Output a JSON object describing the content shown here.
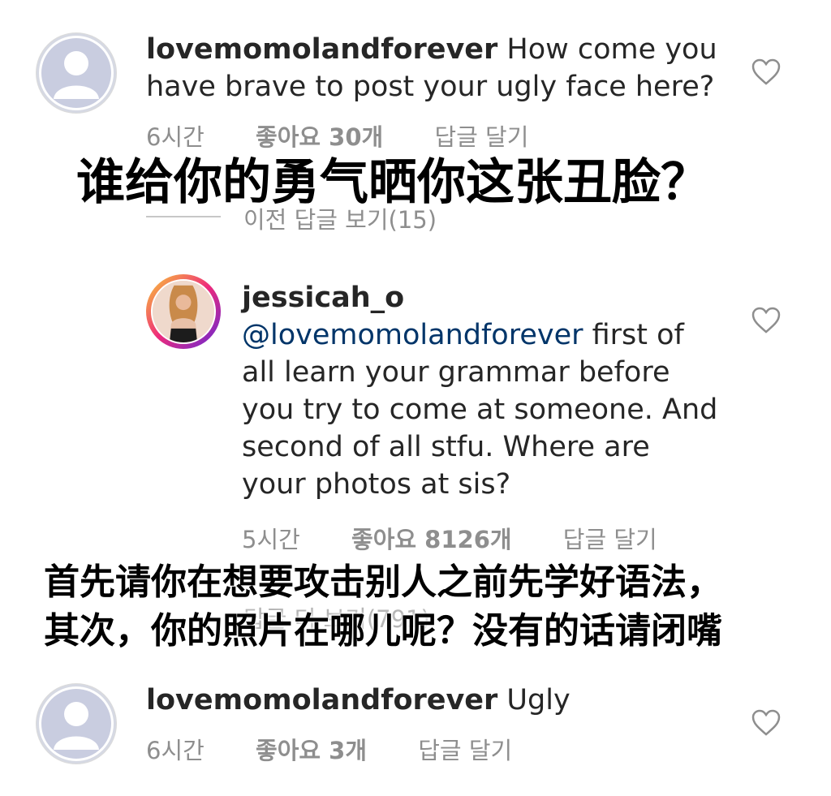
{
  "comments": [
    {
      "username": "lovemomolandforever",
      "text_line1": " How come you",
      "text_line2": "have brave to post your ugly face here?",
      "time": "6시간",
      "likes": "좋아요 30개",
      "reply": "답글 달기",
      "view_replies": "이전 답글 보기(15)",
      "avatar_icon": "default-user-icon"
    },
    {
      "username": "jessicah_o",
      "mention": "@lovemomolandforever",
      "lines": [
        " first of",
        "all learn your grammar before",
        "you try to come at someone. And",
        "second of all stfu. Where are",
        "your photos at sis?"
      ],
      "time": "5시간",
      "likes": "좋아요 8126개",
      "reply": "답글 달기",
      "view_more": "답글 더 보기(791)",
      "avatar_icon": "profile-photo-icon"
    },
    {
      "username": "lovemomolandforever",
      "text": " Ugly",
      "time": "6시간",
      "likes": "좋아요 3개",
      "reply": "답글 달기",
      "avatar_icon": "default-user-icon"
    }
  ],
  "captions": {
    "caption1": "谁给你的勇气晒你这张丑脸？",
    "caption2_line1": "首先请你在想要攻击别人之前先学好语法，",
    "caption2_line2": "其次，你的照片在哪儿呢？没有的话请闭嘴"
  },
  "colors": {
    "text": "#262626",
    "meta": "#8e8e8e",
    "mention": "#003569",
    "caption": "#000000"
  }
}
